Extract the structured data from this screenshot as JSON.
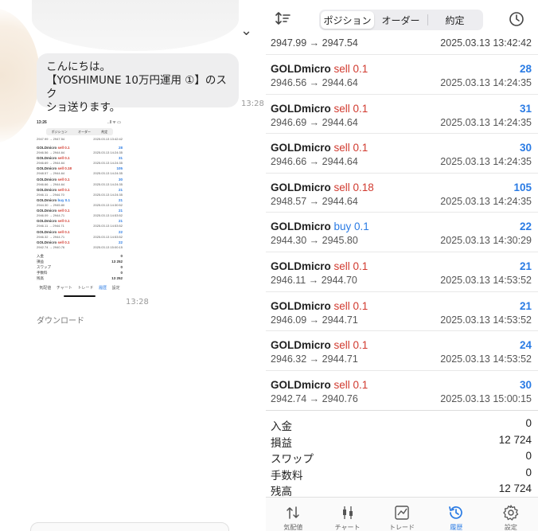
{
  "chat": {
    "message_lines": [
      "こんにちは。",
      "【YOSHIMUNE 10万円運用 ①】のスク",
      "ショ送ります。"
    ],
    "message_time": "13:28",
    "image_time": "13:28",
    "download_label": "ダウンロード",
    "thumbnail": {
      "status_time": "13:26",
      "status_right": "..ll ᯤ ▭",
      "tabs": [
        "ポジション",
        "オーダー",
        "約定"
      ],
      "partial_left": "2947.99 → 2947.54",
      "partial_right": "2025.03.13 13:42:42",
      "rows": [
        {
          "symbol": "GOLDmicro",
          "side": "sell 0.1",
          "prices": "2946.56 → 2944.64",
          "profit": "28",
          "time": "2025.03.13 14:24:35"
        },
        {
          "symbol": "GOLDmicro",
          "side": "sell 0.1",
          "prices": "2946.69 → 2944.64",
          "profit": "31",
          "time": "2025.03.13 14:24:35"
        },
        {
          "symbol": "GOLDmicro",
          "side": "sell 0.18",
          "prices": "2948.57 → 2944.64",
          "profit": "105",
          "time": "2025.03.13 14:24:35"
        },
        {
          "symbol": "GOLDmicro",
          "side": "sell 0.1",
          "prices": "2946.66 → 2944.64",
          "profit": "30",
          "time": "2025.03.13 14:24:35"
        },
        {
          "symbol": "GOLDmicro",
          "side": "sell 0.1",
          "prices": "2946.11 → 2944.70",
          "profit": "21",
          "time": "2025.03.13 14:24:35"
        },
        {
          "symbol": "GOLDmicro",
          "side": "buy 0.1",
          "prices": "2944.30 → 2945.80",
          "profit": "21",
          "time": "2025.03.13 14:30:52"
        },
        {
          "symbol": "GOLDmicro",
          "side": "sell 0.1",
          "prices": "2946.09 → 2944.71",
          "profit": "21",
          "time": "2025.03.13 14:53:52"
        },
        {
          "symbol": "GOLDmicro",
          "side": "sell 0.1",
          "prices": "2946.11 → 2944.71",
          "profit": "21",
          "time": "2025.03.13 14:53:52"
        },
        {
          "symbol": "GOLDmicro",
          "side": "sell 0.1",
          "prices": "2946.32 → 2944.71",
          "profit": "22",
          "time": "2025.03.13 14:53:52"
        },
        {
          "symbol": "GOLDmicro",
          "side": "sell 0.1",
          "prices": "2942.74 → 2940.76",
          "profit": "22",
          "time": "2025.03.13 15:00:15"
        }
      ],
      "summary": [
        {
          "k": "入金",
          "v": "0"
        },
        {
          "k": "損益",
          "v": "13 252"
        },
        {
          "k": "スワップ",
          "v": "0"
        },
        {
          "k": "手数料",
          "v": "0"
        },
        {
          "k": "残高",
          "v": "13 252"
        }
      ],
      "nav": [
        "気配値",
        "チャート",
        "トレード",
        "履歴",
        "設定"
      ]
    }
  },
  "app": {
    "tabs": [
      "ポジション",
      "オーダー",
      "約定"
    ],
    "active_tab": 0,
    "partial_row": {
      "prices": "2947.99 → 2947.54",
      "time": "2025.03.13 13:42:42"
    },
    "rows": [
      {
        "symbol": "GOLDmicro",
        "side": "sell 0.1",
        "side_type": "sell",
        "prices": "2946.56 → 2944.64",
        "profit": "28",
        "time": "2025.03.13 14:24:35"
      },
      {
        "symbol": "GOLDmicro",
        "side": "sell 0.1",
        "side_type": "sell",
        "prices": "2946.69 → 2944.64",
        "profit": "31",
        "time": "2025.03.13 14:24:35"
      },
      {
        "symbol": "GOLDmicro",
        "side": "sell 0.1",
        "side_type": "sell",
        "prices": "2946.66 → 2944.64",
        "profit": "30",
        "time": "2025.03.13 14:24:35"
      },
      {
        "symbol": "GOLDmicro",
        "side": "sell 0.18",
        "side_type": "sell",
        "prices": "2948.57 → 2944.64",
        "profit": "105",
        "time": "2025.03.13 14:24:35"
      },
      {
        "symbol": "GOLDmicro",
        "side": "buy 0.1",
        "side_type": "buy",
        "prices": "2944.30 → 2945.80",
        "profit": "22",
        "time": "2025.03.13 14:30:29"
      },
      {
        "symbol": "GOLDmicro",
        "side": "sell 0.1",
        "side_type": "sell",
        "prices": "2946.11 → 2944.70",
        "profit": "21",
        "time": "2025.03.13 14:53:52"
      },
      {
        "symbol": "GOLDmicro",
        "side": "sell 0.1",
        "side_type": "sell",
        "prices": "2946.09 → 2944.71",
        "profit": "21",
        "time": "2025.03.13 14:53:52"
      },
      {
        "symbol": "GOLDmicro",
        "side": "sell 0.1",
        "side_type": "sell",
        "prices": "2946.32 → 2944.71",
        "profit": "24",
        "time": "2025.03.13 14:53:52"
      },
      {
        "symbol": "GOLDmicro",
        "side": "sell 0.1",
        "side_type": "sell",
        "prices": "2942.74 → 2940.76",
        "profit": "30",
        "time": "2025.03.13 15:00:15"
      }
    ],
    "summary": [
      {
        "label": "入金",
        "value": "0"
      },
      {
        "label": "損益",
        "value": "12 724"
      },
      {
        "label": "スワップ",
        "value": "0"
      },
      {
        "label": "手数料",
        "value": "0"
      },
      {
        "label": "残高",
        "value": "12 724"
      }
    ],
    "nav": [
      {
        "label": "気配値",
        "icon": "quotes-icon"
      },
      {
        "label": "チャート",
        "icon": "chart-icon"
      },
      {
        "label": "トレード",
        "icon": "trade-icon"
      },
      {
        "label": "履歴",
        "icon": "history-icon"
      },
      {
        "label": "設定",
        "icon": "settings-icon"
      }
    ],
    "active_nav": 3,
    "colors": {
      "sell": "#d13a2f",
      "buy": "#2a7be4",
      "profit": "#2a7be4",
      "active": "#2a7be4"
    }
  }
}
